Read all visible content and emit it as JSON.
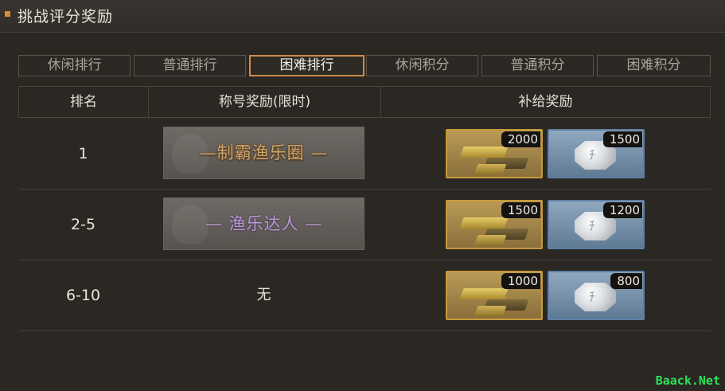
{
  "window": {
    "title": "挑战评分奖励"
  },
  "tabs": [
    {
      "label": "休闲排行",
      "active": false
    },
    {
      "label": "普通排行",
      "active": false
    },
    {
      "label": "困难排行",
      "active": true
    },
    {
      "label": "休闲积分",
      "active": false
    },
    {
      "label": "普通积分",
      "active": false
    },
    {
      "label": "困难积分",
      "active": false
    }
  ],
  "table": {
    "headers": {
      "rank": "排名",
      "title_reward": "称号奖励(限时)",
      "supply_reward": "补给奖励"
    },
    "rows": [
      {
        "rank": "1",
        "title": "—制霸渔乐圈 —",
        "title_style": "gold",
        "gold_count": "2000",
        "silver_count": "1500"
      },
      {
        "rank": "2-5",
        "title": "— 渔乐达人 —",
        "title_style": "purple",
        "gold_count": "1500",
        "silver_count": "1200"
      },
      {
        "rank": "6-10",
        "title": "无",
        "title_style": "none",
        "gold_count": "1000",
        "silver_count": "800"
      }
    ]
  },
  "icons": {
    "gold": "gold-bars-icon",
    "silver": "silver-coin-icon"
  },
  "colors": {
    "accent": "#cf8a46",
    "gold_frame": "#c79a3c",
    "silver_frame": "#5d7fa3"
  },
  "site_watermark": "Baack.Net"
}
